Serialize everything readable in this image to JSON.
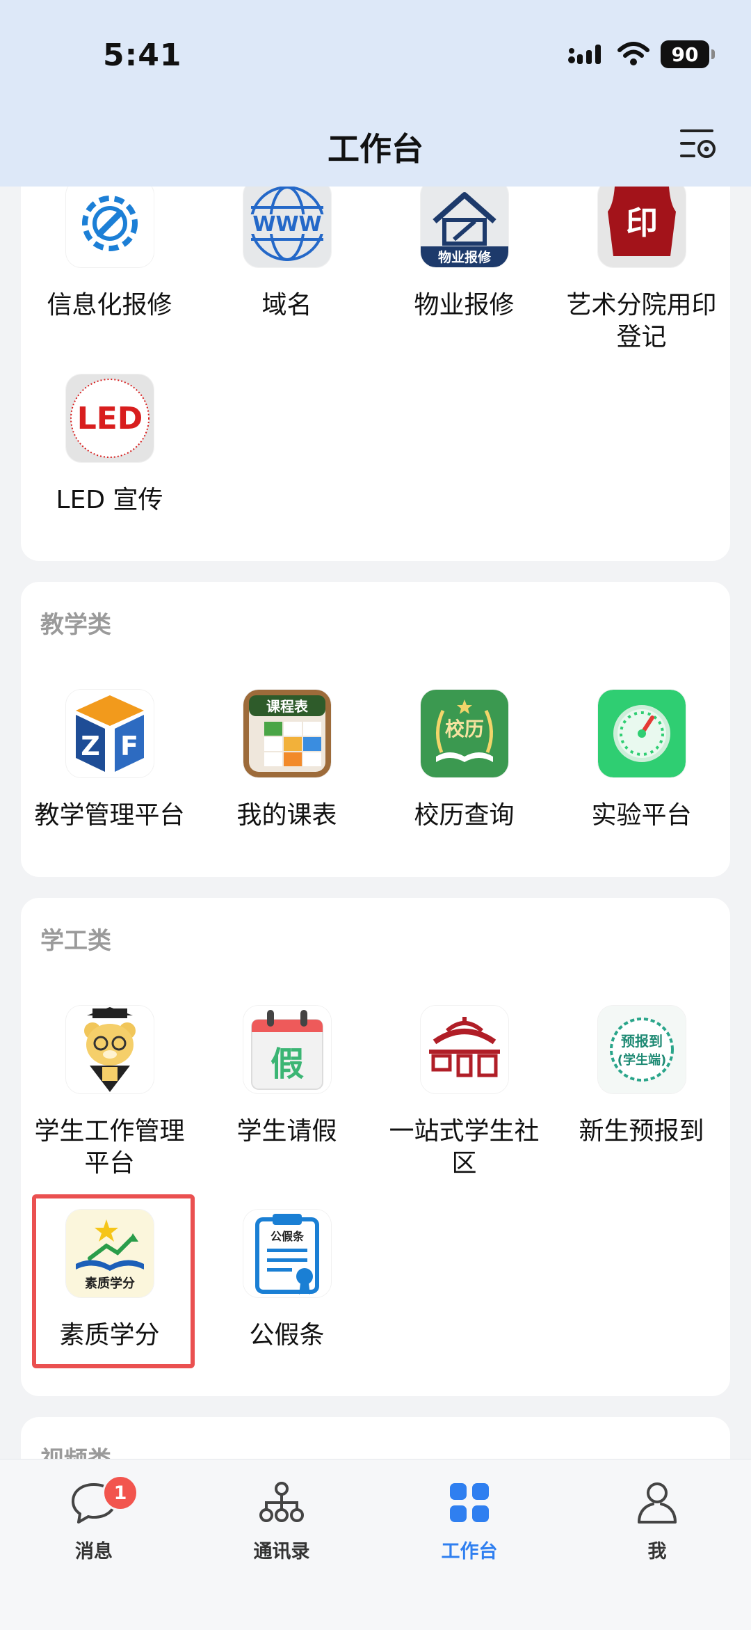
{
  "status_bar": {
    "time": "5:41",
    "battery": "90"
  },
  "header": {
    "title": "工作台"
  },
  "sections": {
    "top": {
      "items": [
        {
          "label": "信息化报修",
          "icon": "gear-wrench-icon"
        },
        {
          "label": "域名",
          "icon": "globe-www-icon"
        },
        {
          "label": "物业报修",
          "icon": "house-repair-icon",
          "icon_text": "物业报修"
        },
        {
          "label": "艺术分院用印登记",
          "icon": "seal-stamp-icon",
          "icon_text": "印"
        },
        {
          "label": "LED 宣传",
          "icon": "led-icon",
          "icon_text": "LED"
        }
      ]
    },
    "teaching": {
      "title": "教学类",
      "items": [
        {
          "label": "教学管理平台",
          "icon": "zf-logo-icon"
        },
        {
          "label": "我的课表",
          "icon": "schedule-icon",
          "icon_text": "课程表"
        },
        {
          "label": "校历查询",
          "icon": "calendar-book-icon",
          "icon_text": "校历"
        },
        {
          "label": "实验平台",
          "icon": "speedometer-icon"
        }
      ]
    },
    "student_affairs": {
      "title": "学工类",
      "items": [
        {
          "label": "学生工作管理平台",
          "icon": "bear-graduate-icon"
        },
        {
          "label": "学生请假",
          "icon": "leave-calendar-icon",
          "icon_text": "假"
        },
        {
          "label": "一站式学生社区",
          "icon": "pavilion-icon"
        },
        {
          "label": "新生预报到",
          "icon": "pre-register-icon",
          "icon_text": "预报到 (学生端)"
        },
        {
          "label": "素质学分",
          "icon": "quality-credit-icon",
          "icon_text": "素质学分"
        },
        {
          "label": "公假条",
          "icon": "certificate-icon",
          "icon_text": "公假条"
        }
      ]
    },
    "video": {
      "title": "视频类"
    }
  },
  "tabbar": {
    "items": [
      {
        "label": "消息",
        "icon": "chat-bubble-icon",
        "badge": "1"
      },
      {
        "label": "通讯录",
        "icon": "org-chart-icon"
      },
      {
        "label": "工作台",
        "icon": "grid-icon",
        "active": true
      },
      {
        "label": "我",
        "icon": "person-icon"
      }
    ]
  },
  "colors": {
    "accent": "#2f7ff0",
    "highlight_border": "#ea5050",
    "badge": "#f2554e"
  }
}
